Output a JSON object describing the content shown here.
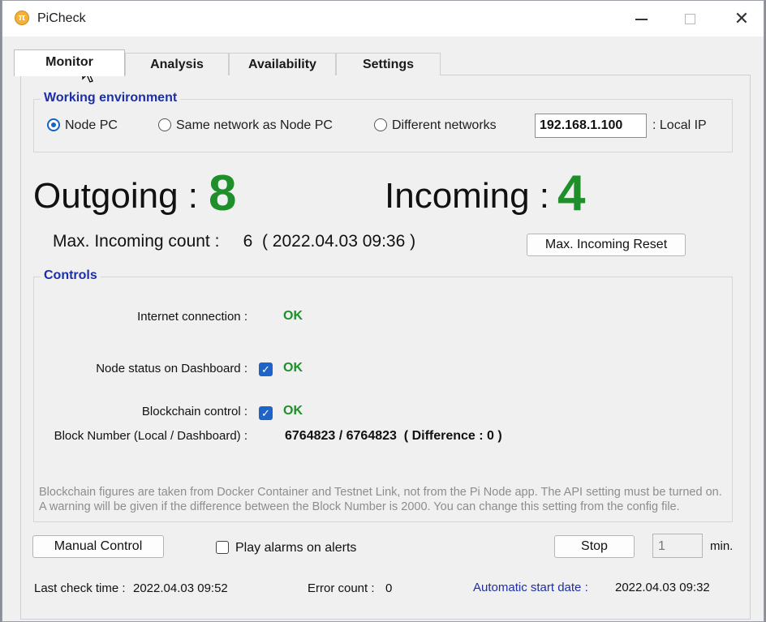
{
  "window": {
    "title": "PiCheck",
    "icon_symbol": "π",
    "close_symbol": "✕"
  },
  "tabs": [
    {
      "label": "Monitor",
      "active": true
    },
    {
      "label": "Analysis",
      "active": false
    },
    {
      "label": "Availability",
      "active": false
    },
    {
      "label": "Settings",
      "active": false
    }
  ],
  "environment": {
    "title": "Working environment",
    "options": [
      {
        "label": "Node PC",
        "selected": true
      },
      {
        "label": "Same network as Node PC",
        "selected": false
      },
      {
        "label": "Different networks",
        "selected": false
      }
    ],
    "ip_value": "192.168.1.100",
    "ip_label": ": Local IP"
  },
  "connections": {
    "outgoing_label": "Outgoing :",
    "outgoing_value": "8",
    "incoming_label": "Incoming :",
    "incoming_value": "4",
    "max_incoming_text": "Max. Incoming count :     6  ( 2022.04.03 09:36 )",
    "reset_button": "Max. Incoming Reset"
  },
  "controls": {
    "title": "Controls",
    "internet_label": "Internet connection :",
    "internet_status": "OK",
    "node_status_label": "Node status on Dashboard :",
    "node_status": "OK",
    "blockchain_label": "Blockchain control :",
    "blockchain_status": "OK",
    "block_number_label": "Block Number  (Local / Dashboard) :",
    "block_number_value": "6764823 / 6764823  ( Difference : 0 )",
    "note_line1": "Blockchain figures are taken from Docker Container and Testnet Link, not from the Pi Node app. The API setting must be turned on.",
    "note_line2": "A warning will be given if the difference between the Block Number is 2000. You can change this setting from the config file."
  },
  "bottom": {
    "manual_button": "Manual Control",
    "alarm_label": "Play alarms on alerts",
    "stop_button": "Stop",
    "interval_value": "1",
    "interval_unit": "min.",
    "last_check_label": "Last check time :",
    "last_check_value": "2022.04.03 09:52",
    "error_count_label": "Error count :",
    "error_count_value": "0",
    "auto_start_label": "Automatic start date :",
    "auto_start_value": "2022.04.03 09:32"
  },
  "colors": {
    "ok_green": "#1e8f2a",
    "group_blue": "#1c2fa6",
    "check_blue": "#1e64c8"
  }
}
